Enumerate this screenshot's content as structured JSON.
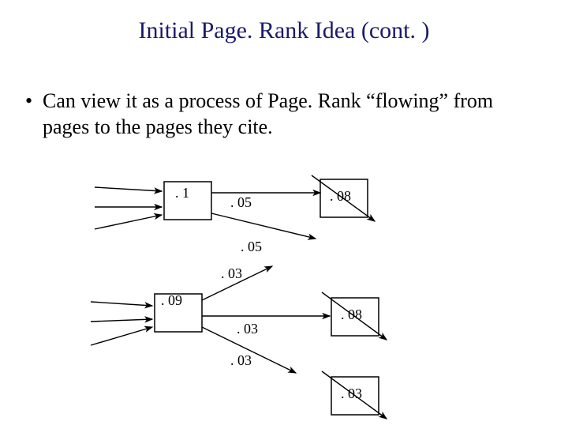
{
  "title": "Initial Page. Rank Idea (cont. )",
  "bullet": "Can view it as a process of Page. Rank “flowing” from pages to the pages they cite.",
  "nodes": {
    "n1": ". 1",
    "n2": ". 08",
    "n3": ". 09",
    "n4": ". 08",
    "n5": ". 03"
  },
  "edges": {
    "e1": ". 05",
    "e2": ". 05",
    "e3": ". 03",
    "e4": ". 03",
    "e5": ". 03"
  }
}
